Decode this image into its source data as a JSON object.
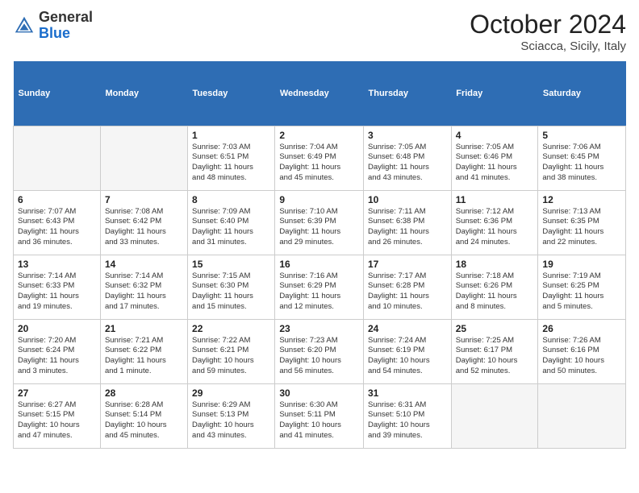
{
  "header": {
    "logo_general": "General",
    "logo_blue": "Blue",
    "month_title": "October 2024",
    "location": "Sciacca, Sicily, Italy"
  },
  "days_of_week": [
    "Sunday",
    "Monday",
    "Tuesday",
    "Wednesday",
    "Thursday",
    "Friday",
    "Saturday"
  ],
  "weeks": [
    [
      {
        "day": null
      },
      {
        "day": null
      },
      {
        "day": "1",
        "lines": [
          "Sunrise: 7:03 AM",
          "Sunset: 6:51 PM",
          "Daylight: 11 hours",
          "and 48 minutes."
        ]
      },
      {
        "day": "2",
        "lines": [
          "Sunrise: 7:04 AM",
          "Sunset: 6:49 PM",
          "Daylight: 11 hours",
          "and 45 minutes."
        ]
      },
      {
        "day": "3",
        "lines": [
          "Sunrise: 7:05 AM",
          "Sunset: 6:48 PM",
          "Daylight: 11 hours",
          "and 43 minutes."
        ]
      },
      {
        "day": "4",
        "lines": [
          "Sunrise: 7:05 AM",
          "Sunset: 6:46 PM",
          "Daylight: 11 hours",
          "and 41 minutes."
        ]
      },
      {
        "day": "5",
        "lines": [
          "Sunrise: 7:06 AM",
          "Sunset: 6:45 PM",
          "Daylight: 11 hours",
          "and 38 minutes."
        ]
      }
    ],
    [
      {
        "day": "6",
        "lines": [
          "Sunrise: 7:07 AM",
          "Sunset: 6:43 PM",
          "Daylight: 11 hours",
          "and 36 minutes."
        ]
      },
      {
        "day": "7",
        "lines": [
          "Sunrise: 7:08 AM",
          "Sunset: 6:42 PM",
          "Daylight: 11 hours",
          "and 33 minutes."
        ]
      },
      {
        "day": "8",
        "lines": [
          "Sunrise: 7:09 AM",
          "Sunset: 6:40 PM",
          "Daylight: 11 hours",
          "and 31 minutes."
        ]
      },
      {
        "day": "9",
        "lines": [
          "Sunrise: 7:10 AM",
          "Sunset: 6:39 PM",
          "Daylight: 11 hours",
          "and 29 minutes."
        ]
      },
      {
        "day": "10",
        "lines": [
          "Sunrise: 7:11 AM",
          "Sunset: 6:38 PM",
          "Daylight: 11 hours",
          "and 26 minutes."
        ]
      },
      {
        "day": "11",
        "lines": [
          "Sunrise: 7:12 AM",
          "Sunset: 6:36 PM",
          "Daylight: 11 hours",
          "and 24 minutes."
        ]
      },
      {
        "day": "12",
        "lines": [
          "Sunrise: 7:13 AM",
          "Sunset: 6:35 PM",
          "Daylight: 11 hours",
          "and 22 minutes."
        ]
      }
    ],
    [
      {
        "day": "13",
        "lines": [
          "Sunrise: 7:14 AM",
          "Sunset: 6:33 PM",
          "Daylight: 11 hours",
          "and 19 minutes."
        ]
      },
      {
        "day": "14",
        "lines": [
          "Sunrise: 7:14 AM",
          "Sunset: 6:32 PM",
          "Daylight: 11 hours",
          "and 17 minutes."
        ]
      },
      {
        "day": "15",
        "lines": [
          "Sunrise: 7:15 AM",
          "Sunset: 6:30 PM",
          "Daylight: 11 hours",
          "and 15 minutes."
        ]
      },
      {
        "day": "16",
        "lines": [
          "Sunrise: 7:16 AM",
          "Sunset: 6:29 PM",
          "Daylight: 11 hours",
          "and 12 minutes."
        ]
      },
      {
        "day": "17",
        "lines": [
          "Sunrise: 7:17 AM",
          "Sunset: 6:28 PM",
          "Daylight: 11 hours",
          "and 10 minutes."
        ]
      },
      {
        "day": "18",
        "lines": [
          "Sunrise: 7:18 AM",
          "Sunset: 6:26 PM",
          "Daylight: 11 hours",
          "and 8 minutes."
        ]
      },
      {
        "day": "19",
        "lines": [
          "Sunrise: 7:19 AM",
          "Sunset: 6:25 PM",
          "Daylight: 11 hours",
          "and 5 minutes."
        ]
      }
    ],
    [
      {
        "day": "20",
        "lines": [
          "Sunrise: 7:20 AM",
          "Sunset: 6:24 PM",
          "Daylight: 11 hours",
          "and 3 minutes."
        ]
      },
      {
        "day": "21",
        "lines": [
          "Sunrise: 7:21 AM",
          "Sunset: 6:22 PM",
          "Daylight: 11 hours",
          "and 1 minute."
        ]
      },
      {
        "day": "22",
        "lines": [
          "Sunrise: 7:22 AM",
          "Sunset: 6:21 PM",
          "Daylight: 10 hours",
          "and 59 minutes."
        ]
      },
      {
        "day": "23",
        "lines": [
          "Sunrise: 7:23 AM",
          "Sunset: 6:20 PM",
          "Daylight: 10 hours",
          "and 56 minutes."
        ]
      },
      {
        "day": "24",
        "lines": [
          "Sunrise: 7:24 AM",
          "Sunset: 6:19 PM",
          "Daylight: 10 hours",
          "and 54 minutes."
        ]
      },
      {
        "day": "25",
        "lines": [
          "Sunrise: 7:25 AM",
          "Sunset: 6:17 PM",
          "Daylight: 10 hours",
          "and 52 minutes."
        ]
      },
      {
        "day": "26",
        "lines": [
          "Sunrise: 7:26 AM",
          "Sunset: 6:16 PM",
          "Daylight: 10 hours",
          "and 50 minutes."
        ]
      }
    ],
    [
      {
        "day": "27",
        "lines": [
          "Sunrise: 6:27 AM",
          "Sunset: 5:15 PM",
          "Daylight: 10 hours",
          "and 47 minutes."
        ]
      },
      {
        "day": "28",
        "lines": [
          "Sunrise: 6:28 AM",
          "Sunset: 5:14 PM",
          "Daylight: 10 hours",
          "and 45 minutes."
        ]
      },
      {
        "day": "29",
        "lines": [
          "Sunrise: 6:29 AM",
          "Sunset: 5:13 PM",
          "Daylight: 10 hours",
          "and 43 minutes."
        ]
      },
      {
        "day": "30",
        "lines": [
          "Sunrise: 6:30 AM",
          "Sunset: 5:11 PM",
          "Daylight: 10 hours",
          "and 41 minutes."
        ]
      },
      {
        "day": "31",
        "lines": [
          "Sunrise: 6:31 AM",
          "Sunset: 5:10 PM",
          "Daylight: 10 hours",
          "and 39 minutes."
        ]
      },
      {
        "day": null
      },
      {
        "day": null
      }
    ]
  ]
}
